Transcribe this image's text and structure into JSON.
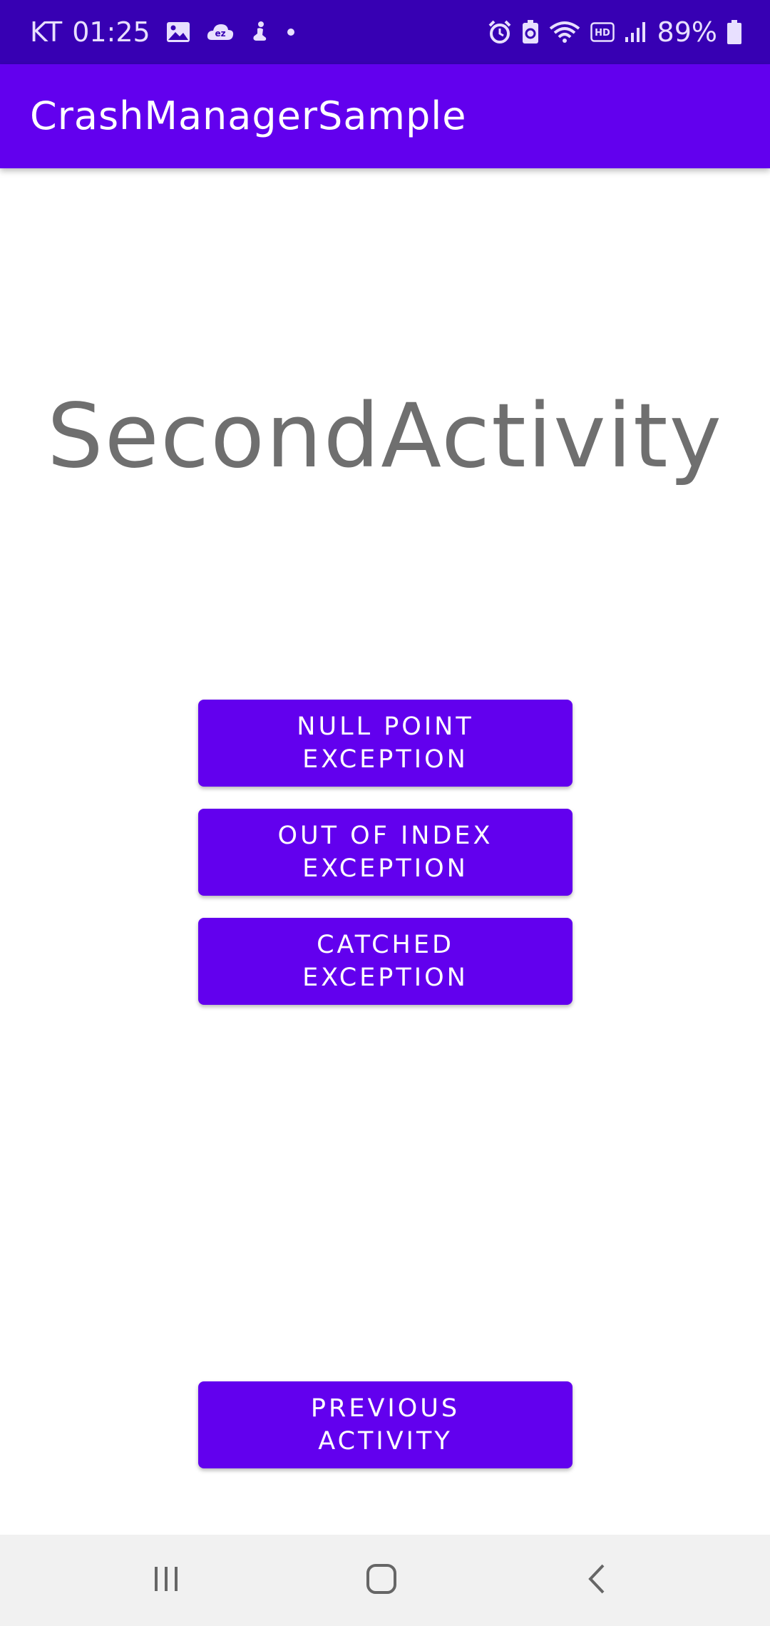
{
  "status_bar": {
    "carrier": "KT",
    "time": "01:25",
    "battery": "89%",
    "left_icons": [
      "gallery-icon",
      "ez-cloud-icon",
      "accessibility-icon",
      "notification-dot-icon"
    ],
    "right_icons": [
      "alarm-icon",
      "battery-saver-icon",
      "wifi-icon",
      "hd-icon",
      "signal-icon",
      "battery-icon"
    ],
    "hd_label": "HD",
    "ez_label": "ez",
    "colors": {
      "background": "#3700b3",
      "text": "#e8e0ff"
    }
  },
  "app_bar": {
    "title": "CrashManagerSample",
    "color": "#6200ee"
  },
  "main": {
    "heading": "SecondActivity",
    "buttons": [
      {
        "line1": "NULL POINT",
        "line2": "EXCEPTION"
      },
      {
        "line1": "OUT OF INDEX",
        "line2": "EXCEPTION"
      },
      {
        "line1": "CATCHED",
        "line2": "EXCEPTION"
      }
    ],
    "previous_button": {
      "line1": "PREVIOUS",
      "line2": "ACTIVITY"
    },
    "button_color": "#6200ee"
  },
  "nav_bar": {
    "icons": [
      "recents-icon",
      "home-icon",
      "back-icon"
    ],
    "color": "#f1f1f1"
  }
}
